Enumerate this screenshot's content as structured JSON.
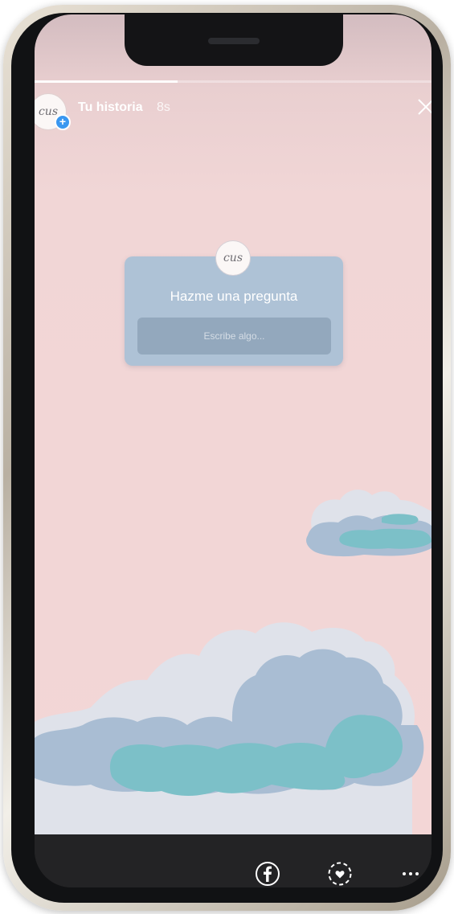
{
  "story": {
    "user": "Tu historia",
    "time": "8s",
    "progress": 0.36,
    "avatar_logo": "cus"
  },
  "sticker": {
    "title": "Hazme una pregunta",
    "input_placeholder": "Escribe algo...",
    "color": "#aec2d6"
  },
  "icons": {
    "close": "close-icon",
    "add": "plus-icon",
    "facebook": "facebook-icon",
    "close_friends": "heart-circle-icon",
    "more": "more-icon"
  },
  "colors": {
    "background": "#f3d6d6",
    "cloud_light": "#dfe2ea",
    "cloud_mid": "#a9bdd3",
    "cloud_teal": "#7cc0c8",
    "badge": "#3a97f0"
  }
}
